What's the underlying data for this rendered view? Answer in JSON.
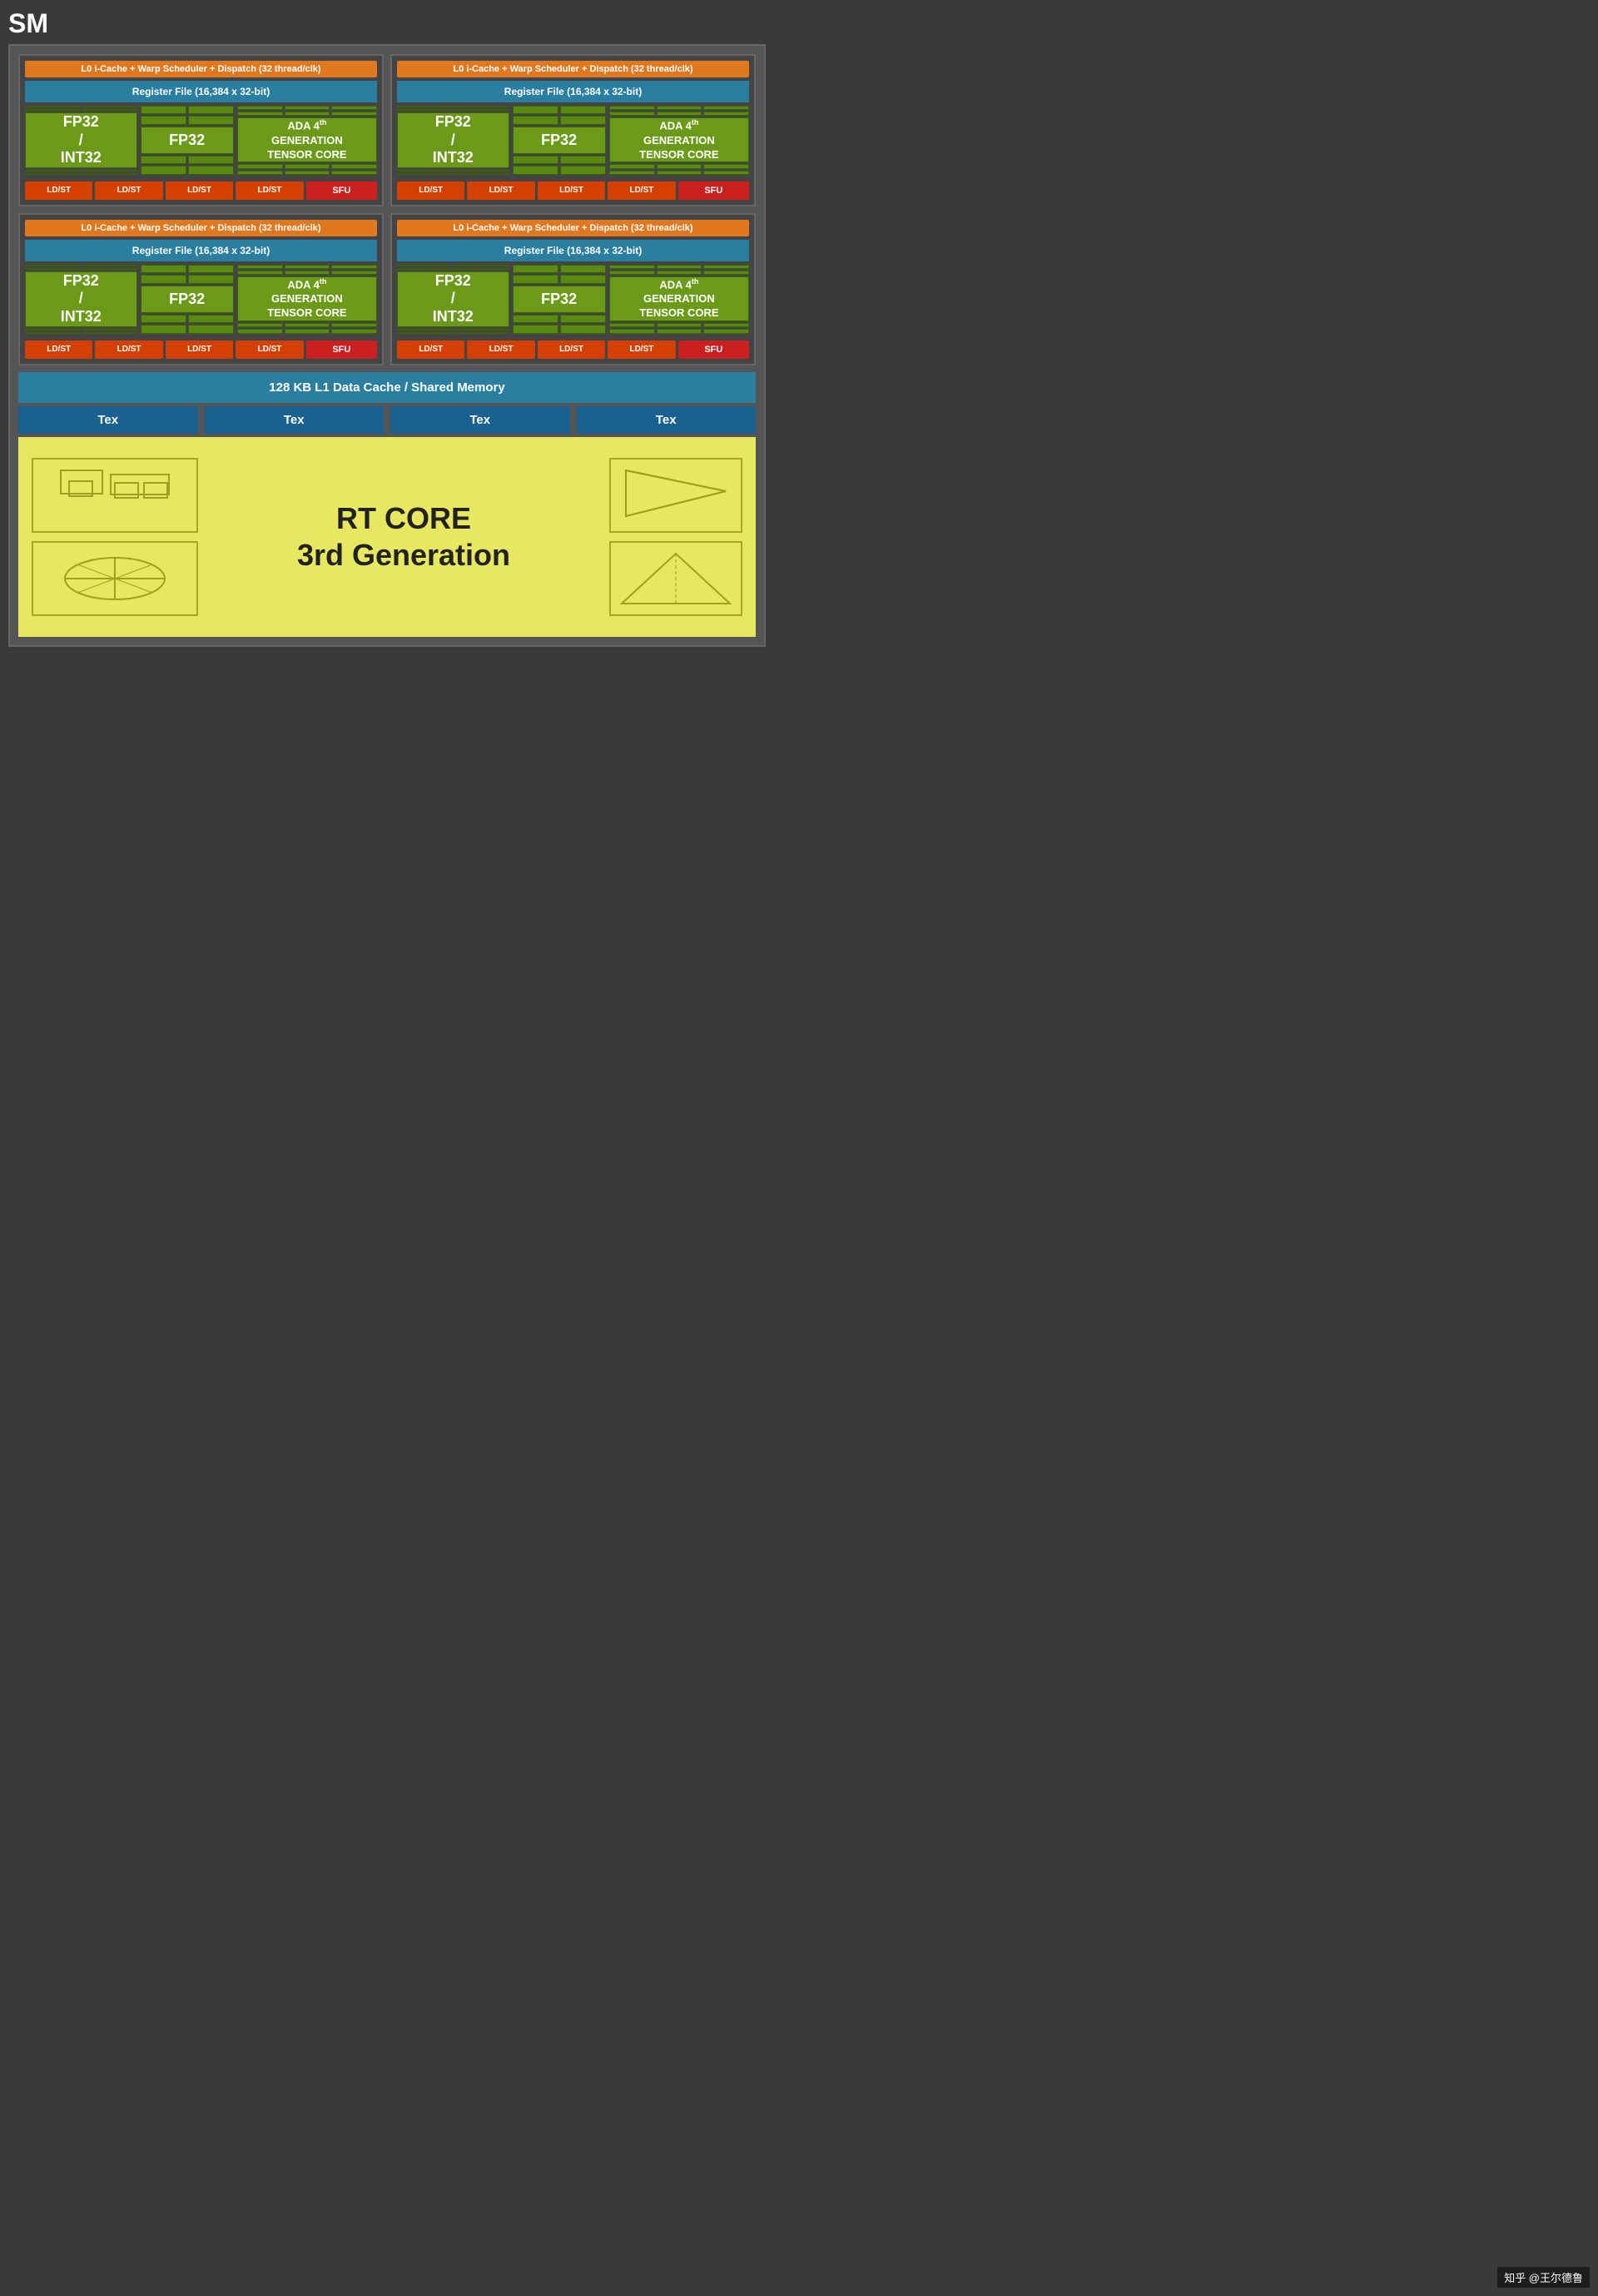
{
  "sm_label": "SM",
  "warp_scheduler": "L0 i-Cache + Warp Scheduler + Dispatch (32 thread/clk)",
  "register_file": "Register File (16,384 x 32-bit)",
  "fp32_int32": "FP32\n/\nINT32",
  "fp32": "FP32",
  "tensor_core": "ADA 4th GENERATION TENSOR CORE",
  "ldst": "LD/ST",
  "sfu": "SFU",
  "l1_cache": "128 KB L1 Data Cache / Shared Memory",
  "tex": "Tex",
  "rt_core_title": "RT CORE",
  "rt_core_subtitle": "3rd Generation",
  "watermark": "知乎 @王尔德鲁",
  "colors": {
    "bg": "#3a3a3a",
    "orange": "#e07820",
    "teal": "#2a7fa0",
    "green": "#5a8a10",
    "red": "#cc2020",
    "yellow": "#e8e860",
    "blue_tex": "#1a6090"
  }
}
